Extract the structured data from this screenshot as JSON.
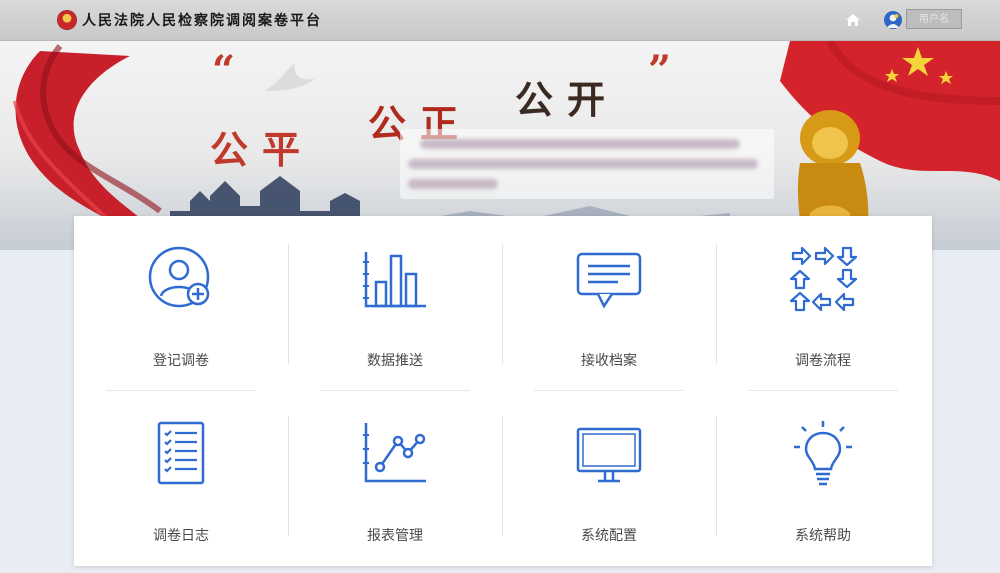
{
  "header": {
    "title": "人民法院人民检察院调阅案卷平台",
    "user_name": "用户名",
    "icons": {
      "logo": "court-emblem-icon",
      "home": "home-icon",
      "avatar": "user-avatar-icon"
    }
  },
  "banner": {
    "quote_open": "“",
    "quote_close": "”",
    "slogans": [
      "公平",
      "公正",
      "公开"
    ]
  },
  "menu": {
    "items": [
      {
        "label": "登记调卷",
        "icon": "register-user-icon"
      },
      {
        "label": "数据推送",
        "icon": "bar-chart-icon"
      },
      {
        "label": "接收档案",
        "icon": "message-icon"
      },
      {
        "label": "调卷流程",
        "icon": "flow-arrows-icon"
      },
      {
        "label": "调卷日志",
        "icon": "checklist-icon"
      },
      {
        "label": "报表管理",
        "icon": "line-chart-icon"
      },
      {
        "label": "系统配置",
        "icon": "monitor-icon"
      },
      {
        "label": "系统帮助",
        "icon": "lightbulb-icon"
      }
    ]
  },
  "colors": {
    "accent": "#2f6bd0",
    "header_bg": "#d0d0d0",
    "slogan_red": "#c0392b"
  }
}
